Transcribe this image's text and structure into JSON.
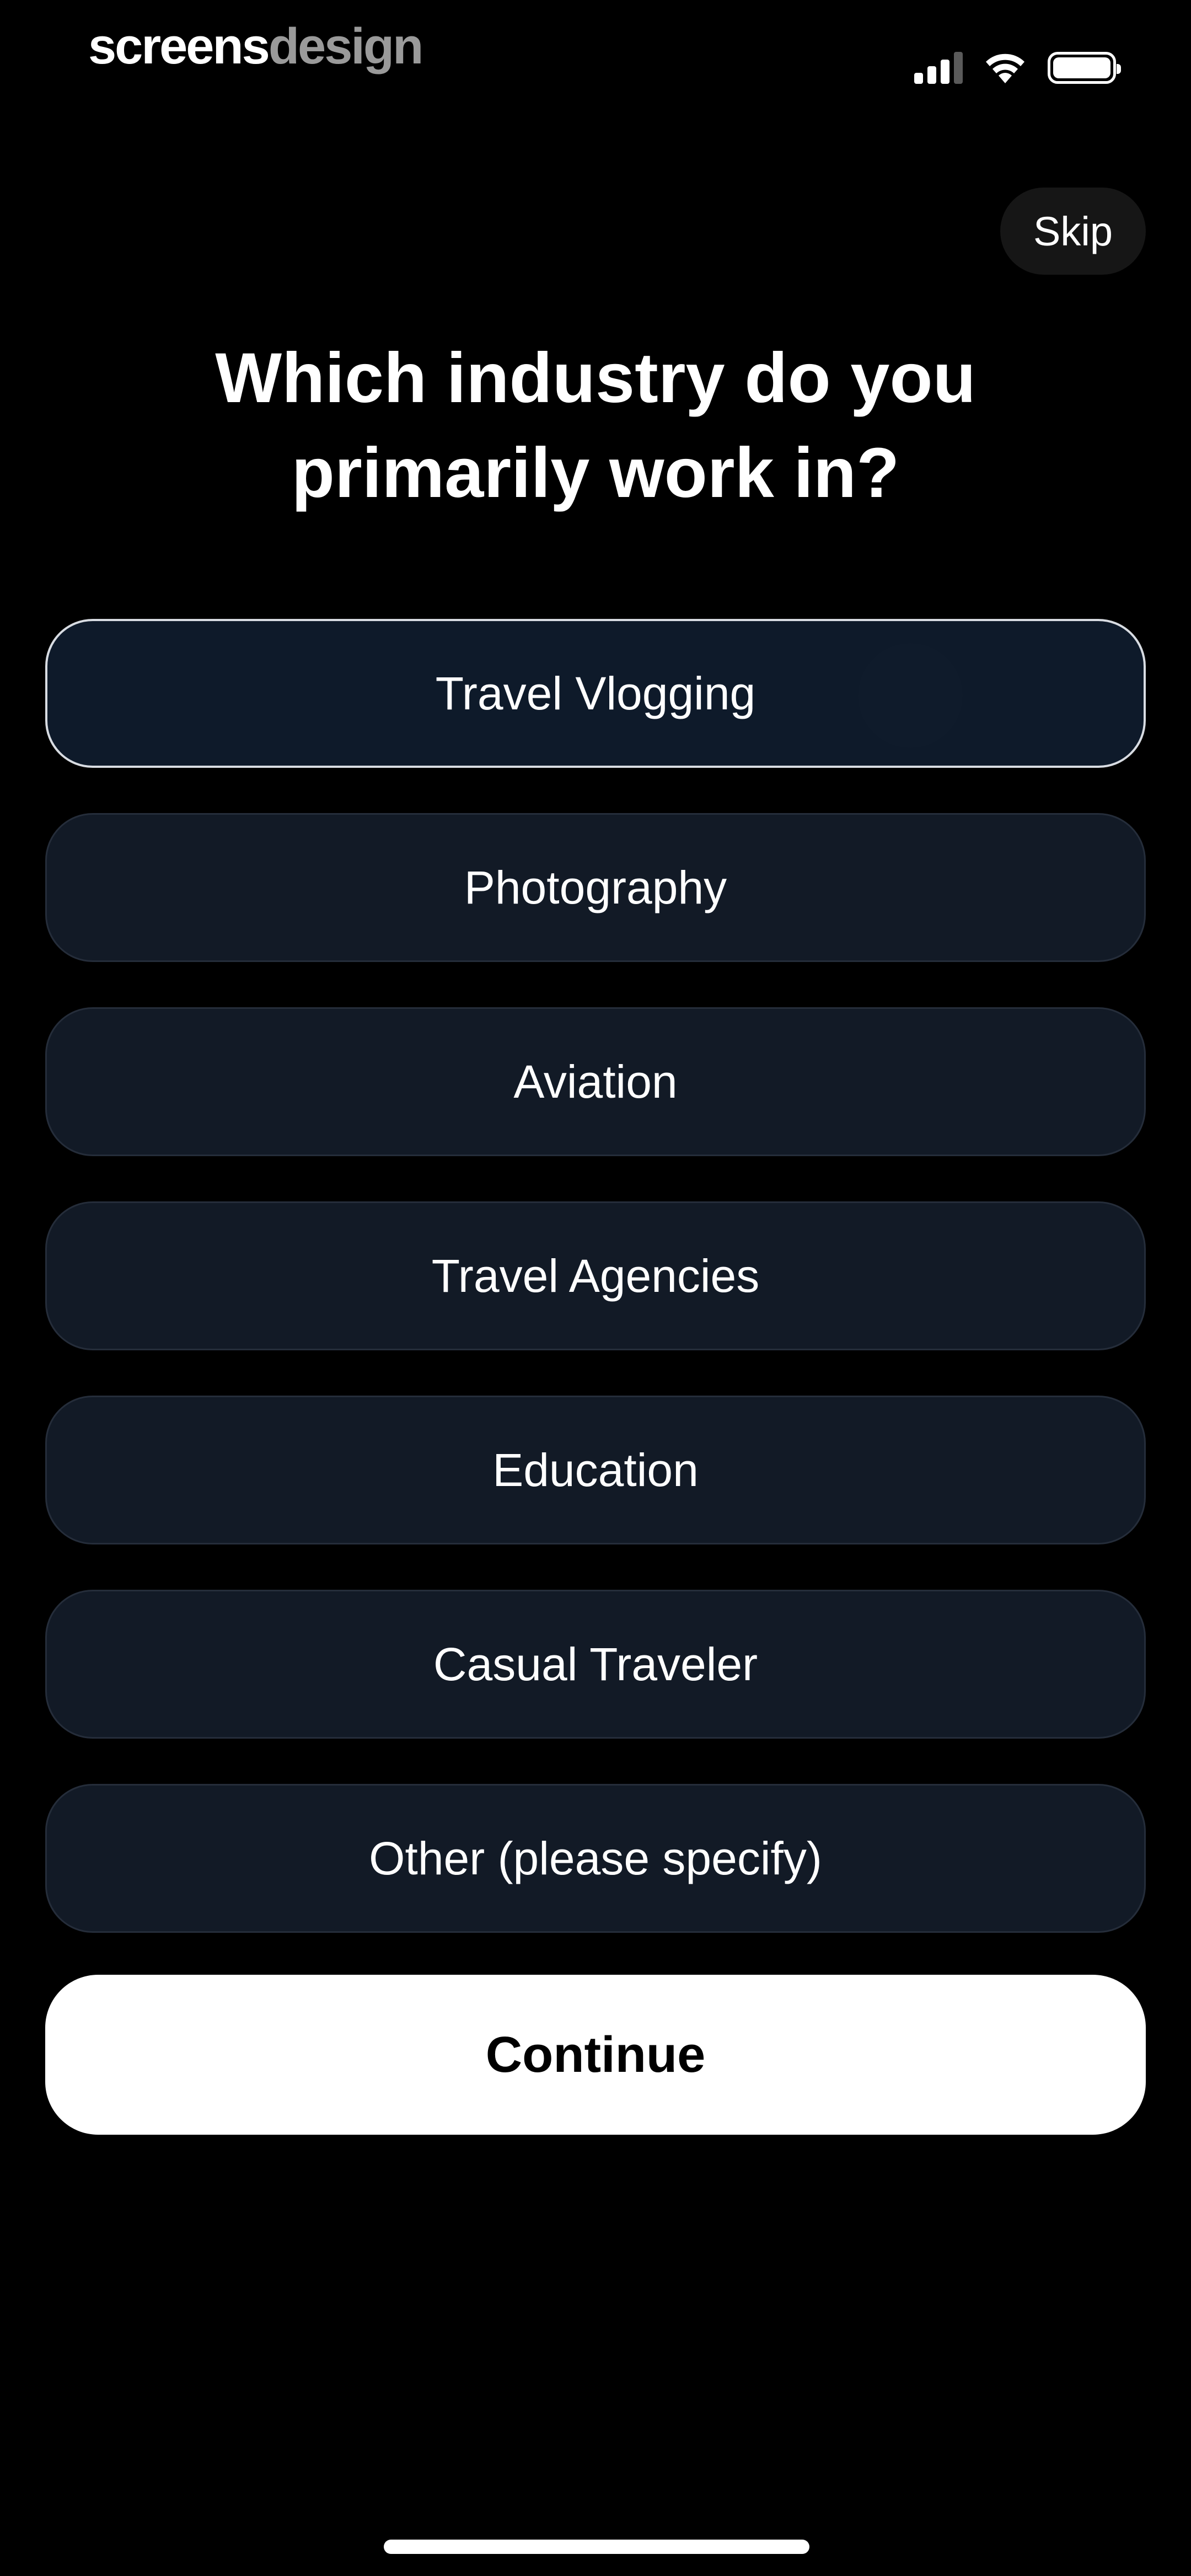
{
  "brand": {
    "part1": "screens",
    "part2": "design"
  },
  "status_bar": {
    "signal_icon": "cellular-signal-icon",
    "wifi_icon": "wifi-icon",
    "battery_icon": "battery-icon",
    "signal_bars_active": 3,
    "signal_bars_total": 4
  },
  "header": {
    "skip_label": "Skip"
  },
  "question": {
    "title": "Which industry do you\nprimarily work in?"
  },
  "options": [
    {
      "label": "Travel Vlogging",
      "selected": true
    },
    {
      "label": "Photography",
      "selected": false
    },
    {
      "label": "Aviation",
      "selected": false
    },
    {
      "label": "Travel Agencies",
      "selected": false
    },
    {
      "label": "Education",
      "selected": false
    },
    {
      "label": "Casual Traveler",
      "selected": false
    },
    {
      "label": "Other (please specify)",
      "selected": false
    }
  ],
  "footer": {
    "continue_label": "Continue"
  },
  "colors": {
    "background": "#000000",
    "option_bg": "#121a26",
    "option_border": "#252d3a",
    "selected_border": "#d8dce2",
    "primary_button_bg": "#ffffff",
    "primary_button_text": "#000000"
  }
}
